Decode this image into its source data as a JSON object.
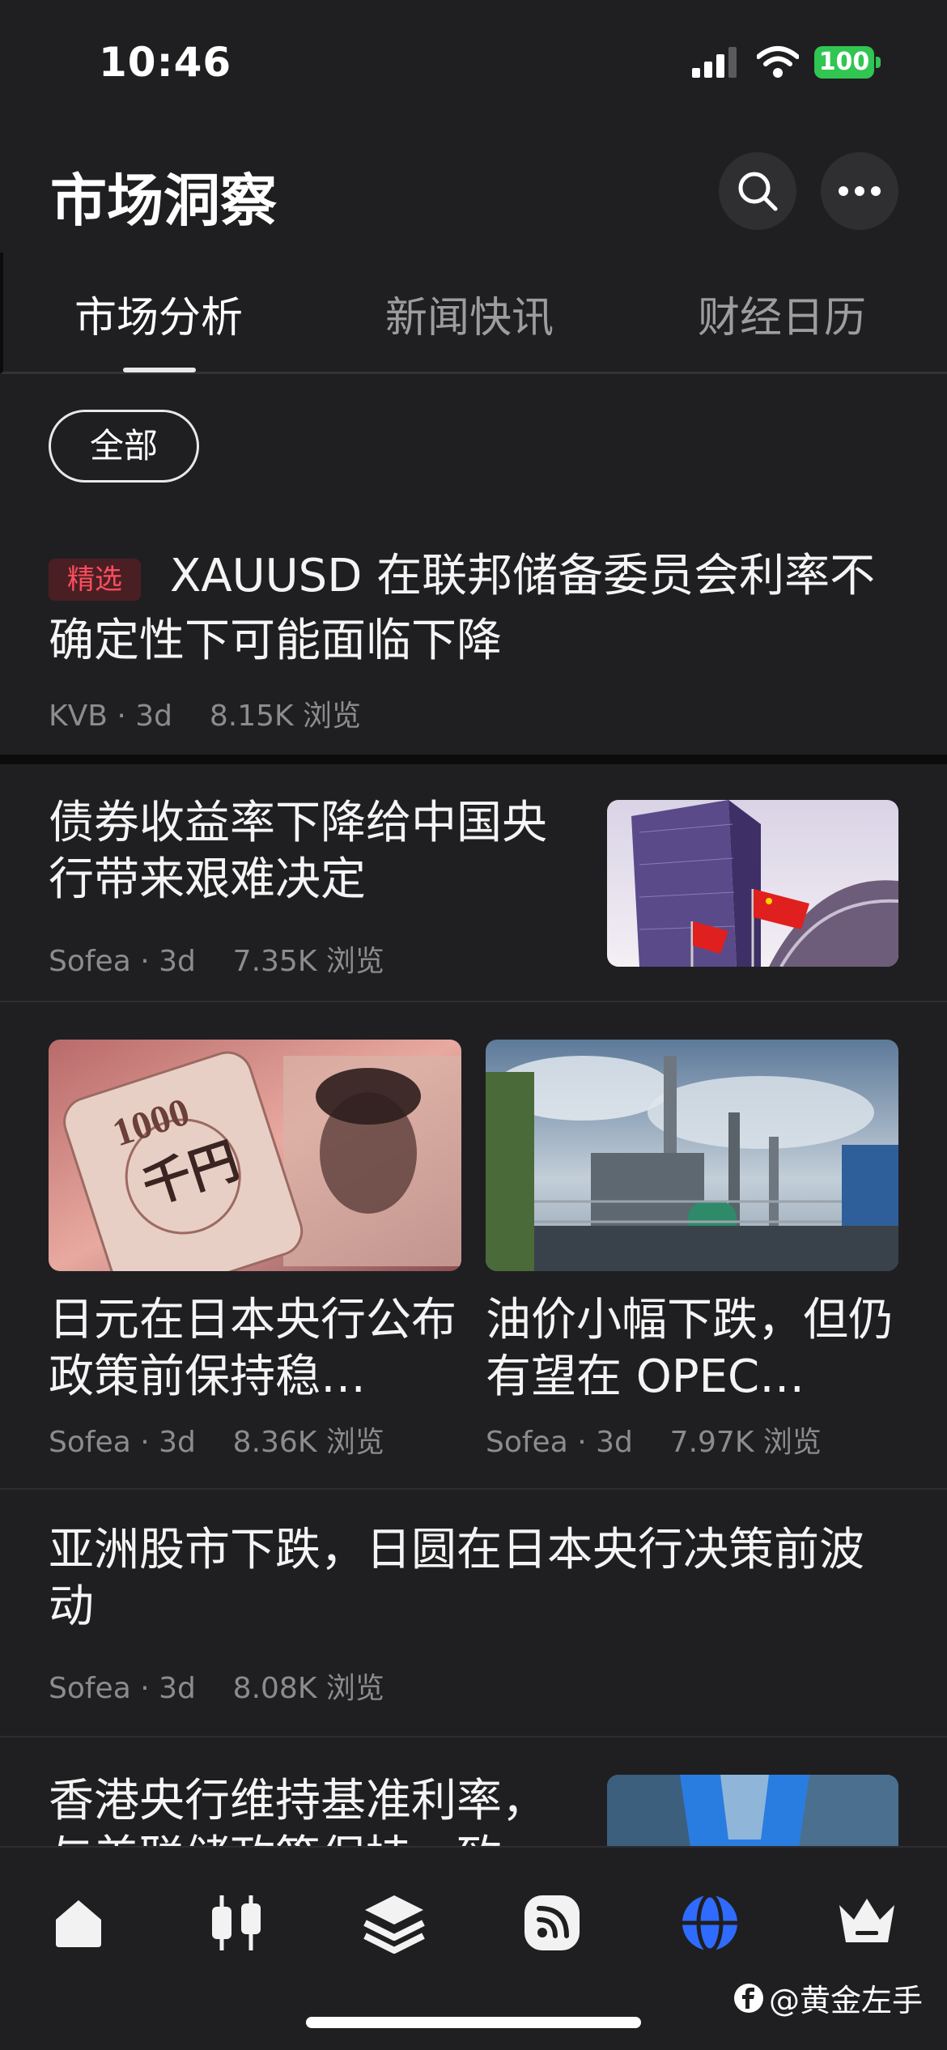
{
  "status_bar": {
    "time": "10:46",
    "battery": "100",
    "battery_color": "#31c552"
  },
  "header": {
    "title": "市场洞察",
    "icons": [
      "search-icon",
      "more-icon"
    ]
  },
  "tabs": [
    {
      "label": "市场分析",
      "active": true
    },
    {
      "label": "新闻快讯",
      "active": false
    },
    {
      "label": "财经日历",
      "active": false
    }
  ],
  "filter": {
    "selected": "全部"
  },
  "articles": [
    {
      "badge": "精选",
      "title": "XAUUSD 在联邦储备委员会利率不确定性下可能面临下降",
      "author": "KVB",
      "age": "3d",
      "views": "8.15K 浏览"
    },
    {
      "title": "债券收益率下降给中国央行带来艰难决定",
      "author": "Sofea",
      "age": "3d",
      "views": "7.35K 浏览",
      "image": "building-flags-image"
    },
    {
      "title": "日元在日本央行公布政策前保持稳…",
      "author": "Sofea",
      "age": "3d",
      "views": "8.36K 浏览",
      "image": "yen-banknote-image"
    },
    {
      "title": "油价小幅下跌，但仍有望在 OPEC…",
      "author": "Sofea",
      "age": "3d",
      "views": "7.97K 浏览",
      "image": "oil-refinery-image"
    },
    {
      "title": "亚洲股市下跌，日圆在日本央行决策前波动",
      "author": "Sofea",
      "age": "3d",
      "views": "8.08K 浏览"
    },
    {
      "title": "香港央行维持基准利率，与美联储政策保持一致",
      "image": "skyscrapers-image"
    }
  ],
  "bottom_nav": [
    "home-icon",
    "candlestick-icon",
    "layers-icon",
    "feed-icon",
    "globe-icon",
    "crown-icon"
  ],
  "active_nav_color": "#2f6bff",
  "watermark": "@黄金左手"
}
